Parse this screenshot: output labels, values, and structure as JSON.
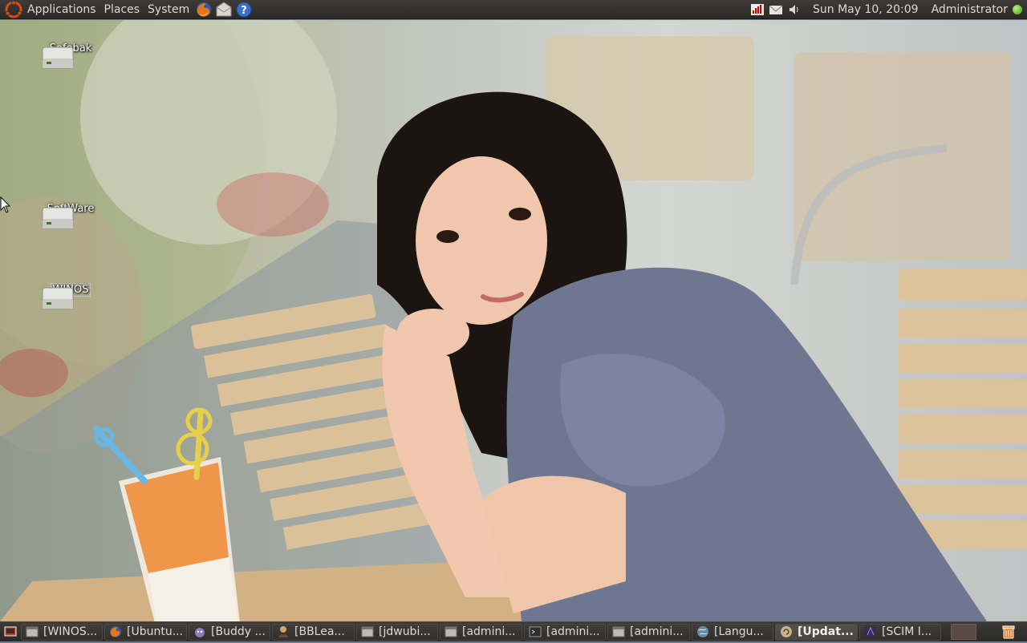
{
  "top_panel": {
    "menus": [
      "Applications",
      "Places",
      "System"
    ],
    "launchers": [
      "firefox-icon",
      "mail-icon",
      "help-icon"
    ],
    "clock": "Sun May 10, 20:09",
    "user": "Administrator"
  },
  "desktop": {
    "icons": [
      {
        "label": "Sofebak",
        "selected": false
      },
      {
        "label": "SoftWare",
        "selected": false
      },
      {
        "label": "WINOS",
        "selected": true
      }
    ]
  },
  "taskbar": {
    "tasks": [
      {
        "label": "[WINOS...",
        "icon": "window-icon",
        "active": false
      },
      {
        "label": "[Ubuntu...",
        "icon": "firefox-icon",
        "active": false
      },
      {
        "label": "[Buddy ...",
        "icon": "pidgin-icon",
        "active": false
      },
      {
        "label": "[BBLea...",
        "icon": "user-icon",
        "active": false
      },
      {
        "label": "[jdwubi...",
        "icon": "window-icon",
        "active": false
      },
      {
        "label": "[admini...",
        "icon": "window-icon",
        "active": false
      },
      {
        "label": "[admini...",
        "icon": "terminal-icon",
        "active": false
      },
      {
        "label": "[admini...",
        "icon": "window-icon",
        "active": false
      },
      {
        "label": "[Langu...",
        "icon": "globe-icon",
        "active": false
      },
      {
        "label": "[Updat...",
        "icon": "update-icon",
        "active": true
      },
      {
        "label": "[SCIM I...",
        "icon": "scim-icon",
        "active": false
      }
    ]
  },
  "colors": {
    "panel_bg": "#2b2a27",
    "panel_text": "#dfdbd2",
    "ubuntu_orange": "#dd4814",
    "status_green": "#4a9a12"
  }
}
